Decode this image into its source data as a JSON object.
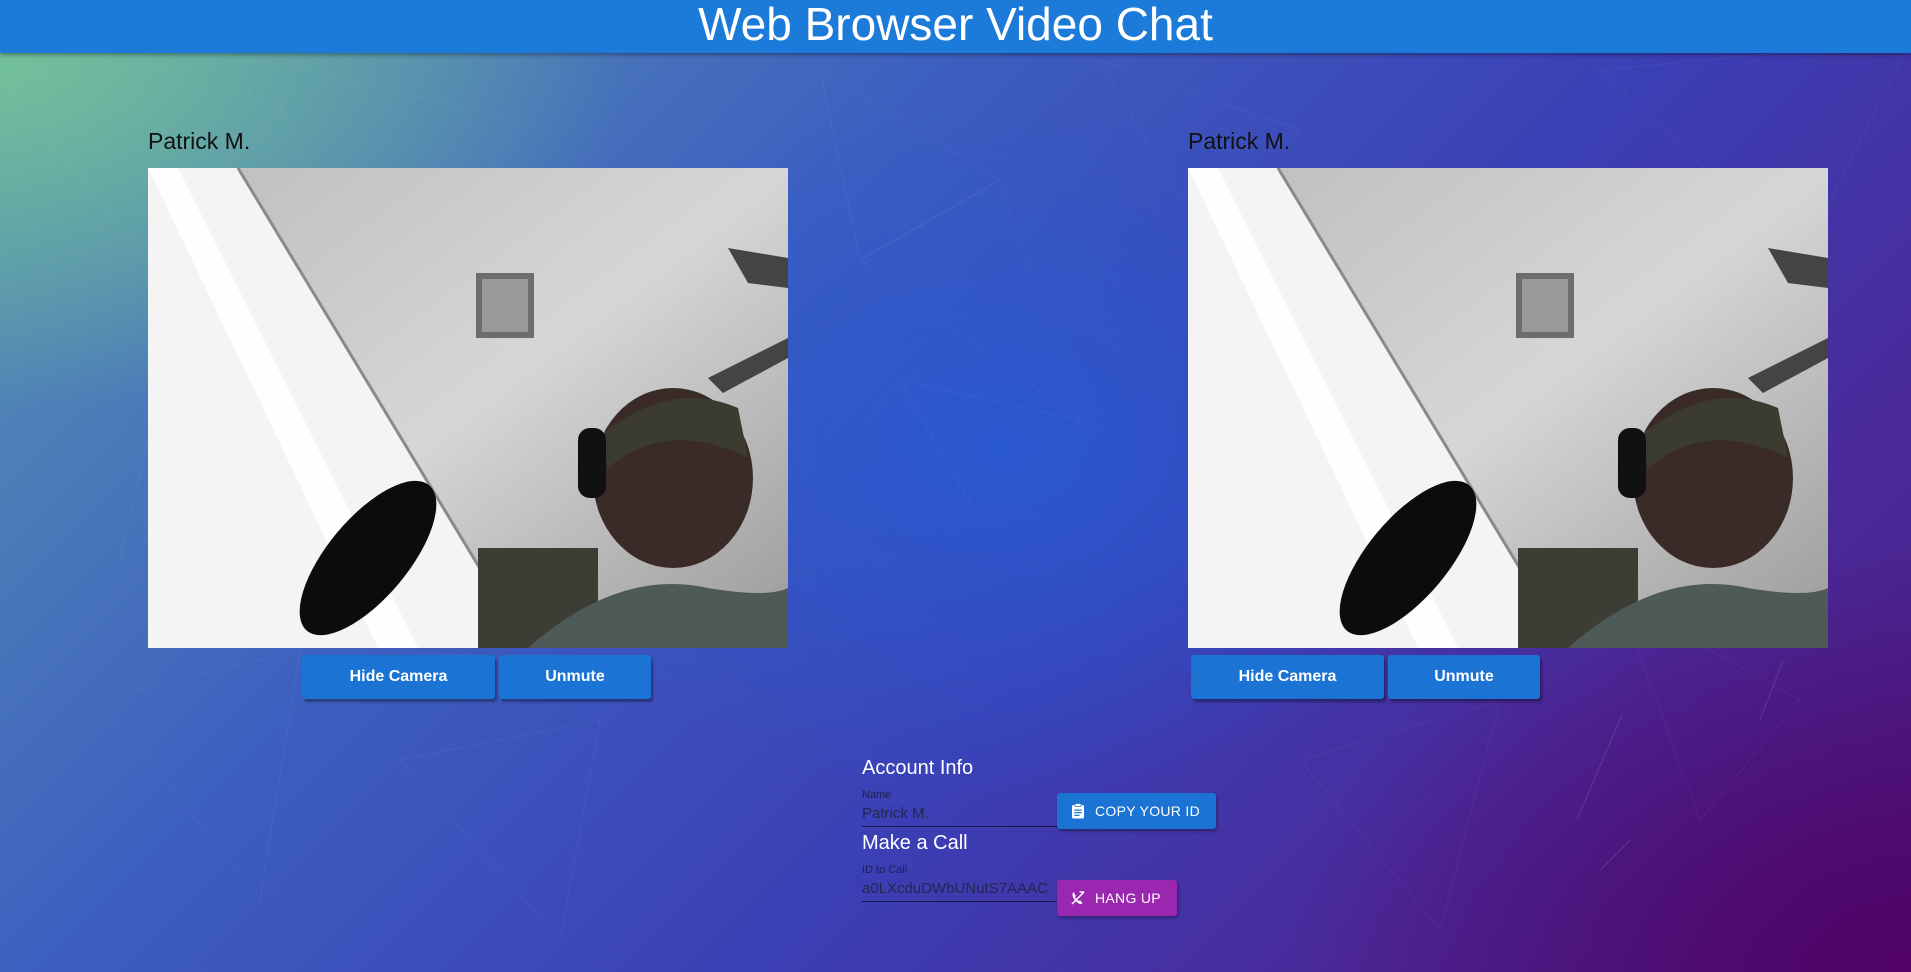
{
  "header": {
    "title": "Web Browser Video Chat"
  },
  "local_video": {
    "name": "Patrick M.",
    "hide_camera_label": "Hide Camera",
    "mute_label": "Unmute"
  },
  "remote_video": {
    "name": "Patrick M.",
    "hide_camera_label": "Hide Camera",
    "mute_label": "Unmute"
  },
  "account": {
    "title": "Account Info",
    "name_label": "Name",
    "name_value": "Patrick M.",
    "copy_id_label": "COPY YOUR ID"
  },
  "call": {
    "title": "Make a Call",
    "id_label": "ID to Call",
    "id_value": "a0LXcduDWbUNutS7AAAC",
    "hang_up_label": "HANG UP"
  },
  "colors": {
    "header": "#1c7ad8",
    "primary_button": "#1b74d4",
    "hang_up_button": "#9b27b0"
  },
  "icons": {
    "copy": "clipboard-icon",
    "hang_up": "call-end-icon"
  }
}
